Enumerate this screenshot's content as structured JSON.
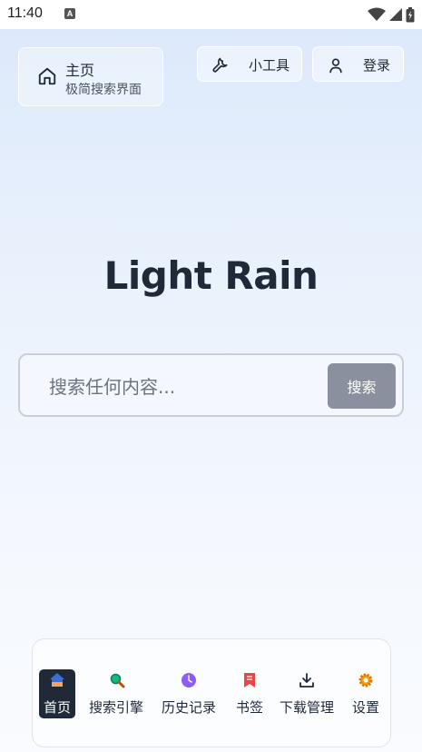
{
  "status_bar": {
    "time": "11:40",
    "notification_badge": "A"
  },
  "header": {
    "home_card": {
      "title": "主页",
      "subtitle": "极简搜索界面",
      "icon": "home-icon"
    },
    "tools_button": {
      "label": "小工具",
      "icon": "wrench-icon"
    },
    "login_button": {
      "label": "登录",
      "icon": "user-icon"
    }
  },
  "brand": {
    "title": "Light Rain"
  },
  "search": {
    "placeholder": "搜索任何内容...",
    "value": "",
    "button_label": "搜索"
  },
  "bottom_nav": {
    "active": "首页",
    "items": [
      {
        "label": "首页",
        "icon": "home-icon",
        "color": "#3b6fd6"
      },
      {
        "label": "搜索引擎",
        "icon": "magnifier-icon",
        "color": "#10b981"
      },
      {
        "label": "历史记录",
        "icon": "clock-icon",
        "color": "#8b5cf6"
      },
      {
        "label": "书签",
        "icon": "bookmark-icon",
        "color": "#ef4444"
      },
      {
        "label": "下载管理",
        "icon": "download-icon",
        "color": "#1f2937"
      },
      {
        "label": "设置",
        "icon": "gear-icon",
        "color": "#f59e0b"
      }
    ]
  },
  "colors": {
    "text_primary": "#1f2937",
    "search_button": "#8a909d",
    "active_nav_bg": "#1f2937"
  }
}
